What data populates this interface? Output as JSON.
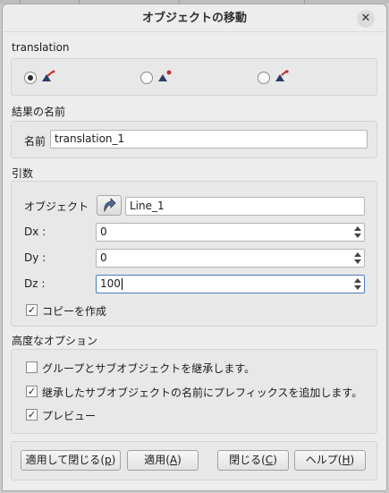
{
  "dialog": {
    "title": "オブジェクトの移動",
    "close_glyph": "✕"
  },
  "translation_section": {
    "label": "translation",
    "options": [
      {
        "icon": "translate-by-vector-icon",
        "selected": true
      },
      {
        "icon": "translate-two-points-icon",
        "selected": false
      },
      {
        "icon": "translate-vector-distance-icon",
        "selected": false
      }
    ]
  },
  "result_section": {
    "label": "結果の名前",
    "name_label": "名前",
    "name_value": "translation_1"
  },
  "args_section": {
    "label": "引数",
    "object_label": "オブジェクト",
    "object_value": "Line_1",
    "dx_label": "Dx :",
    "dx_value": "0",
    "dy_label": "Dy :",
    "dy_value": "0",
    "dz_label": "Dz :",
    "dz_value": "100",
    "copy_label": "コピーを作成",
    "copy_checked": true
  },
  "advanced_section": {
    "label": "高度なオプション",
    "inherit_groups_label": "グループとサブオブジェクトを継承します。",
    "inherit_groups_checked": false,
    "add_prefix_label": "継承したサブオブジェクトの名前にプレフィックスを追加します。",
    "add_prefix_checked": true,
    "preview_label": "プレビュー",
    "preview_checked": true
  },
  "buttons": {
    "apply_close_text": "適用して閉じる(",
    "apply_close_key": "p",
    "apply_text": "適用(",
    "apply_key": "A",
    "close_text": "閉じる(",
    "close_key": "C",
    "help_text": "ヘルプ(",
    "help_key": "H",
    "paren_close": ")"
  },
  "colors": {
    "dialog_bg": "#ededed",
    "group_bg": "#e8e8e8",
    "focus_border": "#4a7bbd"
  }
}
